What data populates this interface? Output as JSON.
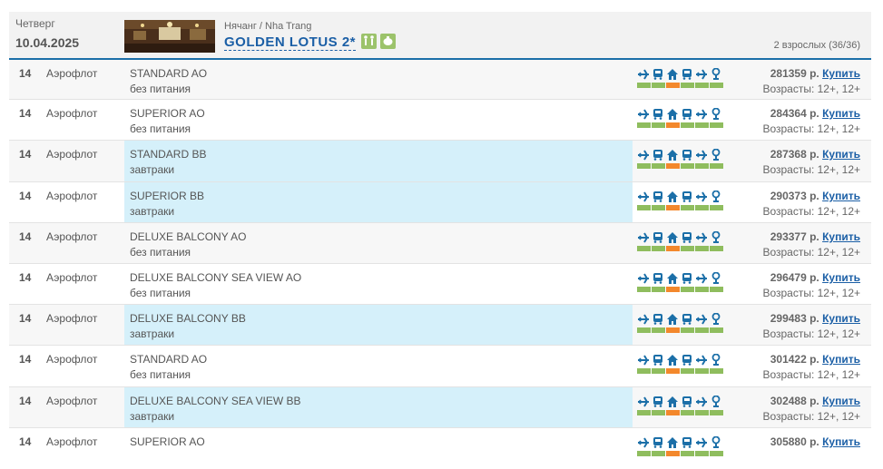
{
  "header": {
    "day": "Четверг",
    "date": "10.04.2025",
    "location": "Нячанг / Nha Trang",
    "hotel": "GOLDEN LOTUS 2*",
    "pax": "2 взрослых (36/36)"
  },
  "colors": {
    "accent": "#1b5fa6",
    "green": "#8fbd5e",
    "orange": "#f3882c",
    "highlight": "#d5f0fa"
  },
  "service_icons": [
    "plane-icon",
    "bus-icon",
    "house-icon",
    "bus-icon",
    "plane-icon",
    "insurance-icon"
  ],
  "rows": [
    {
      "nights": "14",
      "airline": "Аэрофлот",
      "room": "STANDARD AO",
      "meal": "без питания",
      "price": "281359 р.",
      "buy": "Купить",
      "ages": "Возрасты: 12+, 12+",
      "highlight": false
    },
    {
      "nights": "14",
      "airline": "Аэрофлот",
      "room": "SUPERIOR AO",
      "meal": "без питания",
      "price": "284364 р.",
      "buy": "Купить",
      "ages": "Возрасты: 12+, 12+",
      "highlight": false
    },
    {
      "nights": "14",
      "airline": "Аэрофлот",
      "room": "STANDARD BB",
      "meal": "завтраки",
      "price": "287368 р.",
      "buy": "Купить",
      "ages": "Возрасты: 12+, 12+",
      "highlight": true
    },
    {
      "nights": "14",
      "airline": "Аэрофлот",
      "room": "SUPERIOR BB",
      "meal": "завтраки",
      "price": "290373 р.",
      "buy": "Купить",
      "ages": "Возрасты: 12+, 12+",
      "highlight": true
    },
    {
      "nights": "14",
      "airline": "Аэрофлот",
      "room": "DELUXE BALCONY AO",
      "meal": "без питания",
      "price": "293377 р.",
      "buy": "Купить",
      "ages": "Возрасты: 12+, 12+",
      "highlight": false
    },
    {
      "nights": "14",
      "airline": "Аэрофлот",
      "room": "DELUXE BALCONY SEA VIEW AO",
      "meal": "без питания",
      "price": "296479 р.",
      "buy": "Купить",
      "ages": "Возрасты: 12+, 12+",
      "highlight": false
    },
    {
      "nights": "14",
      "airline": "Аэрофлот",
      "room": "DELUXE BALCONY BB",
      "meal": "завтраки",
      "price": "299483 р.",
      "buy": "Купить",
      "ages": "Возрасты: 12+, 12+",
      "highlight": true
    },
    {
      "nights": "14",
      "airline": "Аэрофлот",
      "room": "STANDARD AO",
      "meal": "без питания",
      "price": "301422 р.",
      "buy": "Купить",
      "ages": "Возрасты: 12+, 12+",
      "highlight": false
    },
    {
      "nights": "14",
      "airline": "Аэрофлот",
      "room": "DELUXE BALCONY SEA VIEW BB",
      "meal": "завтраки",
      "price": "302488 р.",
      "buy": "Купить",
      "ages": "Возрасты: 12+, 12+",
      "highlight": true
    },
    {
      "nights": "14",
      "airline": "Аэрофлот",
      "room": "SUPERIOR AO",
      "meal": "",
      "price": "305880 р.",
      "buy": "Купить",
      "ages": "",
      "highlight": false
    }
  ]
}
